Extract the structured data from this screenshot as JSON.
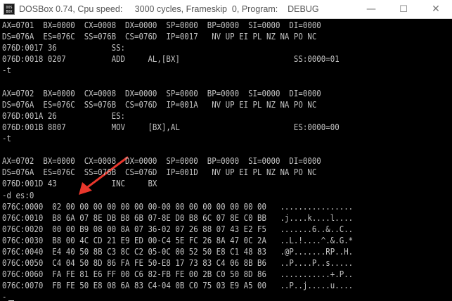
{
  "window": {
    "title": "DOSBox 0.74, Cpu speed:     3000 cycles, Frameskip  0, Program:    DEBUG",
    "icon_text": [
      "DOS",
      "BOX"
    ],
    "minimize_glyph": "—",
    "maximize_glyph": "☐",
    "close_glyph": "✕"
  },
  "console": {
    "lines": [
      "AX=0701  BX=0000  CX=0008  DX=0000  SP=0000  BP=0000  SI=0000  DI=0000",
      "DS=076A  ES=076C  SS=076B  CS=076D  IP=0017   NV UP EI PL NZ NA PO NC",
      "076D:0017 36            SS:",
      "076D:0018 0207          ADD     AL,[BX]                         SS:0000=01",
      "-t",
      "",
      "AX=0702  BX=0000  CX=0008  DX=0000  SP=0000  BP=0000  SI=0000  DI=0000",
      "DS=076A  ES=076C  SS=076B  CS=076D  IP=001A   NV UP EI PL NZ NA PO NC",
      "076D:001A 26            ES:",
      "076D:001B 8807          MOV     [BX],AL                         ES:0000=00",
      "-t",
      "",
      "AX=0702  BX=0000  CX=0008  DX=0000  SP=0000  BP=0000  SI=0000  DI=0000",
      "DS=076A  ES=076C  SS=076B  CS=076D  IP=001D   NV UP EI PL NZ NA PO NC",
      "076D:001D 43            INC     BX",
      "-d es:0",
      "076C:0000  02 00 00 00 00 00 00 00-00 00 00 00 00 00 00 00   ................",
      "076C:0010  B8 6A 07 8E DB B8 6B 07-8E D0 B8 6C 07 8E C0 BB   .j....k....l....",
      "076C:0020  00 00 B9 08 00 8A 07 36-02 07 26 88 07 43 E2 F5   .......6..&..C..",
      "076C:0030  B8 00 4C CD 21 E9 ED 00-C4 5E FC 26 8A 47 0C 2A   ..L.!....^.&.G.*",
      "076C:0040  E4 40 50 8B C3 8C C2 05-0C 00 52 50 E8 C1 48 83   .@P.......RP..H.",
      "076C:0050  C4 04 50 8D 86 FA FE 50-E8 17 73 83 C4 06 8B B6   ..P....P..s.....",
      "076C:0060  FA FE 81 E6 FF 00 C6 82-FB FE 00 2B C0 50 8D 86   ...........+.P..",
      "076C:0070  FB FE 50 E8 08 6A 83 C4-04 0B C0 75 03 E9 A5 00   ..P..j.....u...."
    ],
    "prompt": "-"
  },
  "annotation": {
    "color": "#e8372c"
  }
}
